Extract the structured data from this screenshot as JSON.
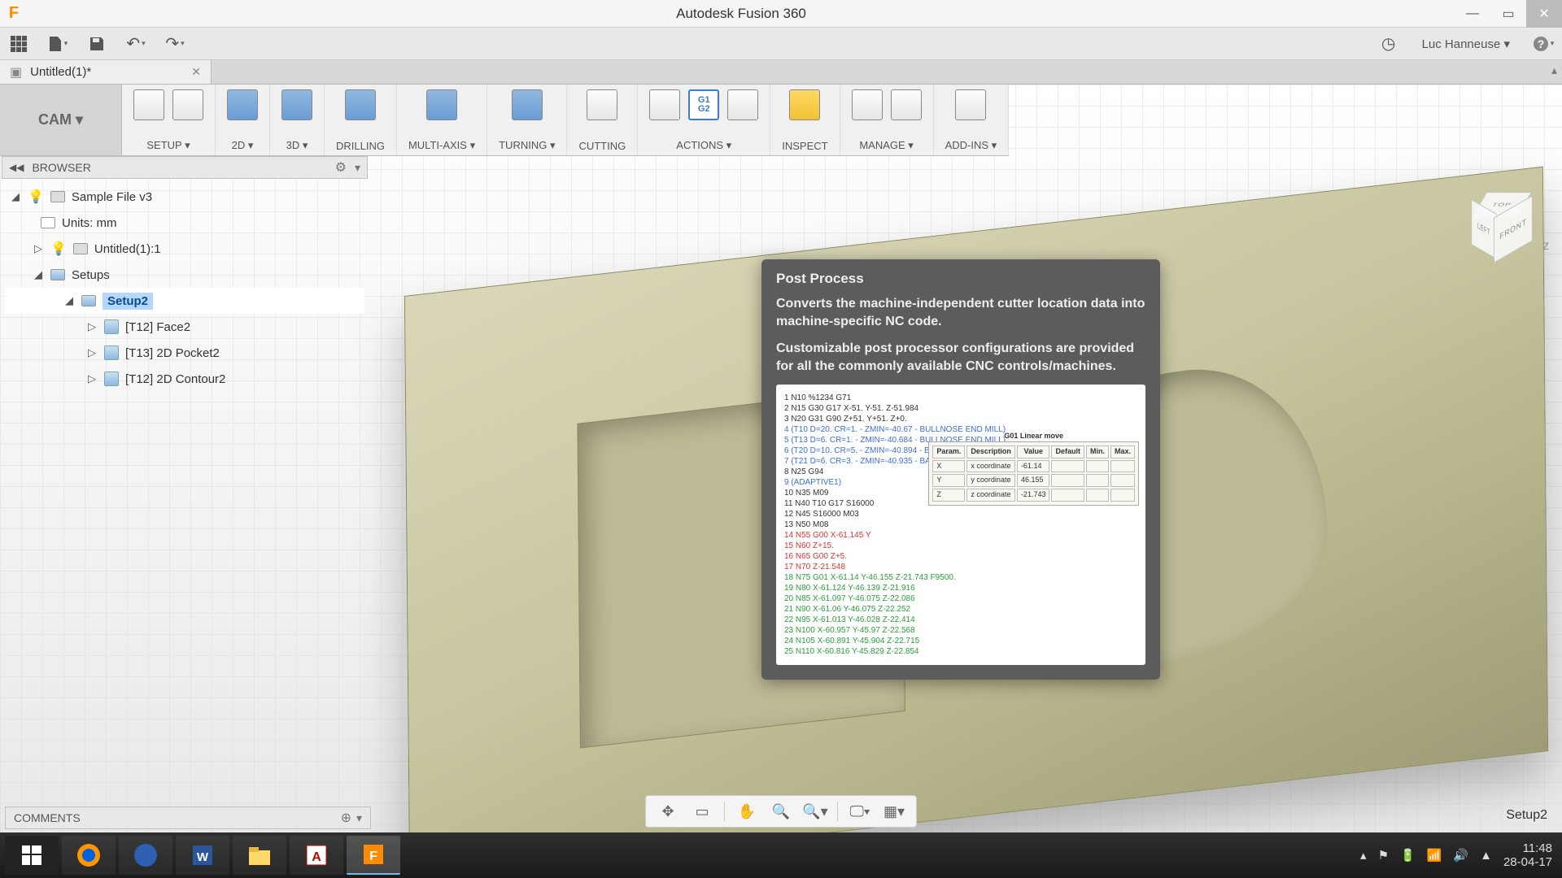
{
  "titlebar": {
    "app_title": "Autodesk Fusion 360"
  },
  "quickaccess": {
    "user_name": "Luc Hanneuse ▾"
  },
  "document_tab": {
    "name": "Untitled(1)*"
  },
  "workspace": {
    "label": "CAM ▾"
  },
  "ribbon": {
    "setup": "SETUP ▾",
    "two_d": "2D ▾",
    "three_d": "3D ▾",
    "drilling": "DRILLING",
    "multiaxis": "MULTI-AXIS ▾",
    "turning": "TURNING ▾",
    "cutting": "CUTTING",
    "actions": "ACTIONS ▾",
    "inspect": "INSPECT",
    "manage": "MANAGE ▾",
    "addins": "ADD-INS ▾"
  },
  "browser": {
    "title": "BROWSER",
    "root": "Sample File v3",
    "units": "Units: mm",
    "untitled": "Untitled(1):1",
    "setups": "Setups",
    "setup2": "Setup2",
    "op1": "[T12] Face2",
    "op2": "[T13] 2D Pocket2",
    "op3": "[T12] 2D Contour2"
  },
  "tooltip": {
    "title": "Post Process",
    "p1": "Converts the machine-independent cutter location data into machine-specific NC code.",
    "p2": "Customizable post processor configurations are provided for all the commonly available CNC controls/machines.",
    "gcode": {
      "l1": "1 N10 %1234 G71",
      "l2": "2 N15 G30 G17 X-51. Y-51. Z-51.984",
      "l3": "3 N20 G31 G90 Z+51. Y+51. Z+0.",
      "l4": "4 (T10  D=20. CR=1. - ZMIN=-40.67 - BULLNOSE END MILL)",
      "l5": "5 (T13  D=6. CR=1. - ZMIN=-40.684 - BULLNOSE END MILL)",
      "l6": "6 (T20  D=10. CR=5. - ZMIN=-40.894 - BALL END MILL)",
      "l7": "7 (T21  D=6. CR=3. - ZMIN=-40.935 - BALL END MILL)",
      "l8": "8 N25 G94",
      "l9": "9 (ADAPTIVE1)",
      "l10": "10 N35 M09",
      "l11": "11 N40 T10 G17 S16000",
      "l12": "12 N45 S16000 M03",
      "l13": "13 N50 M08",
      "l14": "14 N55 G00 X-61.145 Y",
      "l15": "15 N60 Z+15.",
      "l16": "16 N65 G00 Z+5.",
      "l17": "17 N70 Z-21.548",
      "l18": "18 N75 G01 X-61.14 Y-46.155 Z-21.743 F9500.",
      "l19": "19 N80 X-61.124 Y-46.139 Z-21.916",
      "l20": "20 N85 X-61.097 Y-46.075 Z-22.086",
      "l21": "21 N90 X-61.06 Y-46.075 Z-22.252",
      "l22": "22 N95 X-61.013 Y-46.028 Z-22.414",
      "l23": "23 N100 X-60.957 Y-45.97 Z-22.568",
      "l24": "24 N105 X-60.891 Y-45.904 Z-22.715",
      "l25": "25 N110 X-60.816 Y-45.829 Z-22.854"
    },
    "table": {
      "caption": "G01 Linear move",
      "h1": "Param.",
      "h2": "Description",
      "h3": "Value",
      "h4": "Default",
      "h5": "Min.",
      "h6": "Max.",
      "r1c1": "X",
      "r1c2": "x coordinate",
      "r1c3": "-61.14",
      "r2c1": "Y",
      "r2c2": "y coordinate",
      "r2c3": "46.155",
      "r3c1": "Z",
      "r3c2": "z coordinate",
      "r3c3": "-21.743"
    }
  },
  "comments": {
    "title": "COMMENTS"
  },
  "status": {
    "label": "Setup2"
  },
  "viewcube": {
    "top": "TOP",
    "left": "LEFT",
    "front": "FRONT",
    "z": "Z"
  },
  "taskbar": {
    "time": "11:48",
    "date": "28-04-17"
  }
}
